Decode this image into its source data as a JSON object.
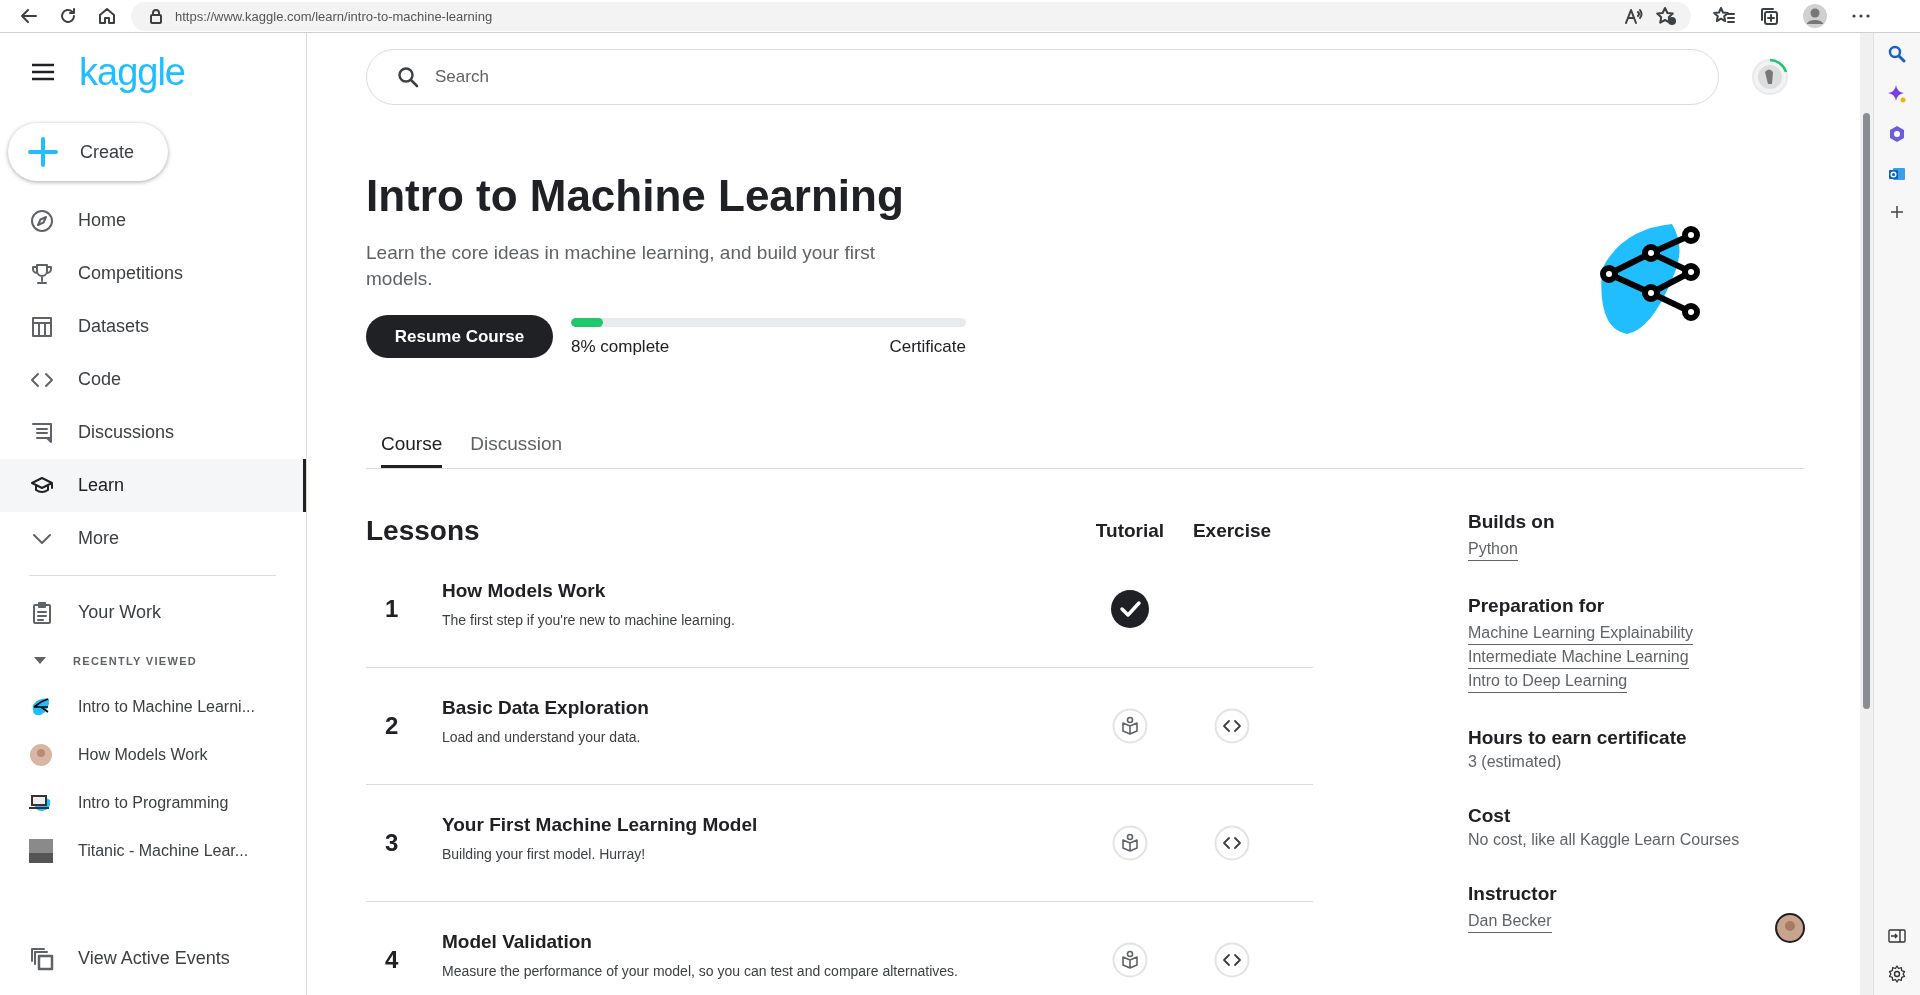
{
  "browser": {
    "url": "https://www.kaggle.com/learn/intro-to-machine-learning"
  },
  "sidebar": {
    "logo": "kaggle",
    "create_label": "Create",
    "nav": [
      {
        "label": "Home",
        "selected": false
      },
      {
        "label": "Competitions",
        "selected": false
      },
      {
        "label": "Datasets",
        "selected": false
      },
      {
        "label": "Code",
        "selected": false
      },
      {
        "label": "Discussions",
        "selected": false
      },
      {
        "label": "Learn",
        "selected": true
      },
      {
        "label": "More",
        "selected": false
      }
    ],
    "your_work": "Your Work",
    "recent_heading": "RECENTLY VIEWED",
    "recent_expanded": true,
    "recent": [
      {
        "label": "Intro to Machine Learni..."
      },
      {
        "label": "How Models Work"
      },
      {
        "label": "Intro to Programming"
      },
      {
        "label": "Titanic - Machine Lear..."
      }
    ],
    "events": "View Active Events"
  },
  "search": {
    "placeholder": "Search"
  },
  "course": {
    "title": "Intro to Machine Learning",
    "description": "Learn the core ideas in machine learning, and build your first models.",
    "resume": "Resume Course",
    "progress": {
      "level": 0.08,
      "label": "8% complete",
      "end_label": "Certificate"
    }
  },
  "tabs": [
    {
      "label": "Course",
      "selected": true
    },
    {
      "label": "Discussion",
      "selected": false
    }
  ],
  "lessons": {
    "heading": "Lessons",
    "columns": [
      "Tutorial",
      "Exercise"
    ],
    "rows": [
      {
        "number": "1",
        "title": "How Models Work",
        "description": "The first step if you're new to machine learning.",
        "tutorial_done": true,
        "has_exercise": false
      },
      {
        "number": "2",
        "title": "Basic Data Exploration",
        "description": "Load and understand your data.",
        "tutorial_done": false,
        "has_exercise": true
      },
      {
        "number": "3",
        "title": "Your First Machine Learning Model",
        "description": "Building your first model. Hurray!",
        "tutorial_done": false,
        "has_exercise": true
      },
      {
        "number": "4",
        "title": "Model Validation",
        "description": "Measure the performance of your model, so you can test and compare alternatives.",
        "tutorial_done": false,
        "has_exercise": true
      }
    ]
  },
  "details": [
    {
      "heading": "Builds on",
      "links": [
        "Python"
      ]
    },
    {
      "heading": "Preparation for",
      "links": [
        "Machine Learning Explainability",
        "Intermediate Machine Learning",
        "Intro to Deep Learning"
      ]
    },
    {
      "heading": "Hours to earn certificate",
      "text": "3 (estimated)"
    },
    {
      "heading": "Cost",
      "text": "No cost, like all Kaggle Learn Courses"
    },
    {
      "heading": "Instructor",
      "links": [
        "Dan Becker"
      ]
    }
  ]
}
